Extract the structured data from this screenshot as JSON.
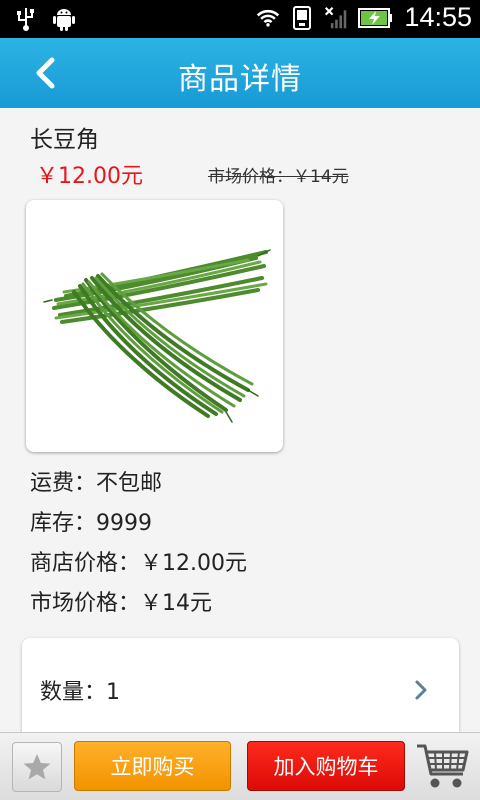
{
  "status_bar": {
    "time": "14:55",
    "icons": [
      "usb-icon",
      "android-icon",
      "wifi-icon",
      "phone-icon",
      "no-signal-icon",
      "battery-charging-icon"
    ]
  },
  "header": {
    "title": "商品详情",
    "back_icon": "back-chevron-icon"
  },
  "product": {
    "name": "长豆角",
    "price": "￥12.00元",
    "market_price_top": "市场价格：￥14元",
    "image_alt": "长豆角"
  },
  "details": {
    "shipping": "运费：不包邮",
    "stock": "库存：9999",
    "store_price": "商店价格：￥12.00元",
    "market_price": "市场价格：￥14元"
  },
  "quantity": {
    "label": "数量：1"
  },
  "bottom_bar": {
    "buy_now": "立即购买",
    "add_to_cart": "加入购物车"
  },
  "colors": {
    "header": "#1ea6dd",
    "price": "#e8161a",
    "buy_now": "#f7a11a",
    "add_to_cart": "#e8140f"
  }
}
